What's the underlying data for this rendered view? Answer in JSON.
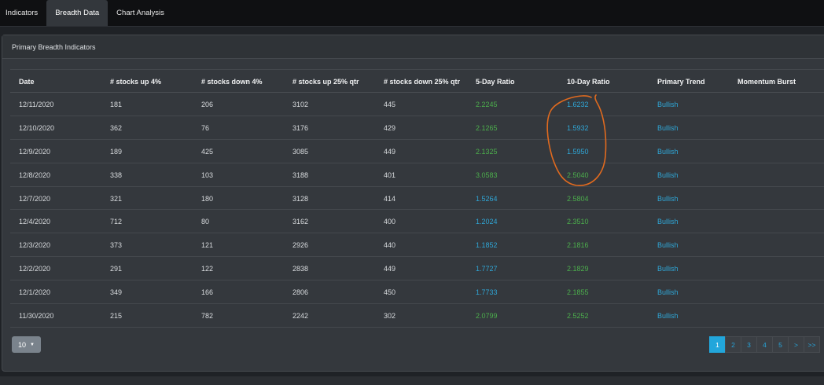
{
  "tabs": [
    {
      "label": "Indicators",
      "active": false
    },
    {
      "label": "Breadth Data",
      "active": true
    },
    {
      "label": "Chart Analysis",
      "active": false
    }
  ],
  "panel": {
    "title": "Primary Breadth Indicators"
  },
  "table": {
    "headers": [
      "Date",
      "# stocks up 4%",
      "# stocks down 4%",
      "# stocks up 25% qtr",
      "# stocks down 25% qtr",
      "5-Day Ratio",
      "10-Day Ratio",
      "Primary Trend",
      "Momentum Burst"
    ],
    "rows": [
      {
        "date": "12/11/2020",
        "up4": "181",
        "down4": "206",
        "up25": "3102",
        "down25": "445",
        "r5": "2.2245",
        "r5_color": "#4cae4c",
        "r10": "1.6232",
        "r10_color": "#2fa6d6",
        "trend": "Bullish",
        "burst": ""
      },
      {
        "date": "12/10/2020",
        "up4": "362",
        "down4": "76",
        "up25": "3176",
        "down25": "429",
        "r5": "2.1265",
        "r5_color": "#4cae4c",
        "r10": "1.5932",
        "r10_color": "#2fa6d6",
        "trend": "Bullish",
        "burst": ""
      },
      {
        "date": "12/9/2020",
        "up4": "189",
        "down4": "425",
        "up25": "3085",
        "down25": "449",
        "r5": "2.1325",
        "r5_color": "#4cae4c",
        "r10": "1.5950",
        "r10_color": "#2fa6d6",
        "trend": "Bullish",
        "burst": ""
      },
      {
        "date": "12/8/2020",
        "up4": "338",
        "down4": "103",
        "up25": "3188",
        "down25": "401",
        "r5": "3.0583",
        "r5_color": "#4cae4c",
        "r10": "2.5040",
        "r10_color": "#4cae4c",
        "trend": "Bullish",
        "burst": ""
      },
      {
        "date": "12/7/2020",
        "up4": "321",
        "down4": "180",
        "up25": "3128",
        "down25": "414",
        "r5": "1.5264",
        "r5_color": "#2fa6d6",
        "r10": "2.5804",
        "r10_color": "#4cae4c",
        "trend": "Bullish",
        "burst": ""
      },
      {
        "date": "12/4/2020",
        "up4": "712",
        "down4": "80",
        "up25": "3162",
        "down25": "400",
        "r5": "1.2024",
        "r5_color": "#2fa6d6",
        "r10": "2.3510",
        "r10_color": "#4cae4c",
        "trend": "Bullish",
        "burst": ""
      },
      {
        "date": "12/3/2020",
        "up4": "373",
        "down4": "121",
        "up25": "2926",
        "down25": "440",
        "r5": "1.1852",
        "r5_color": "#2fa6d6",
        "r10": "2.1816",
        "r10_color": "#4cae4c",
        "trend": "Bullish",
        "burst": ""
      },
      {
        "date": "12/2/2020",
        "up4": "291",
        "down4": "122",
        "up25": "2838",
        "down25": "449",
        "r5": "1.7727",
        "r5_color": "#2fa6d6",
        "r10": "2.1829",
        "r10_color": "#4cae4c",
        "trend": "Bullish",
        "burst": ""
      },
      {
        "date": "12/1/2020",
        "up4": "349",
        "down4": "166",
        "up25": "2806",
        "down25": "450",
        "r5": "1.7733",
        "r5_color": "#2fa6d6",
        "r10": "2.1855",
        "r10_color": "#4cae4c",
        "trend": "Bullish",
        "burst": ""
      },
      {
        "date": "11/30/2020",
        "up4": "215",
        "down4": "782",
        "up25": "2242",
        "down25": "302",
        "r5": "2.0799",
        "r5_color": "#4cae4c",
        "r10": "2.5252",
        "r10_color": "#4cae4c",
        "trend": "Bullish",
        "burst": ""
      }
    ]
  },
  "trend_color": "#2fa6d6",
  "page_size": {
    "value": "10",
    "icon": "caret-down-icon"
  },
  "pagination": {
    "pages": [
      "1",
      "2",
      "3",
      "4",
      "5"
    ],
    "active": "1",
    "next": ">",
    "last": ">>"
  },
  "annotation": {
    "color": "#e06a1f",
    "shape": "hand-drawn-circle-icon"
  }
}
